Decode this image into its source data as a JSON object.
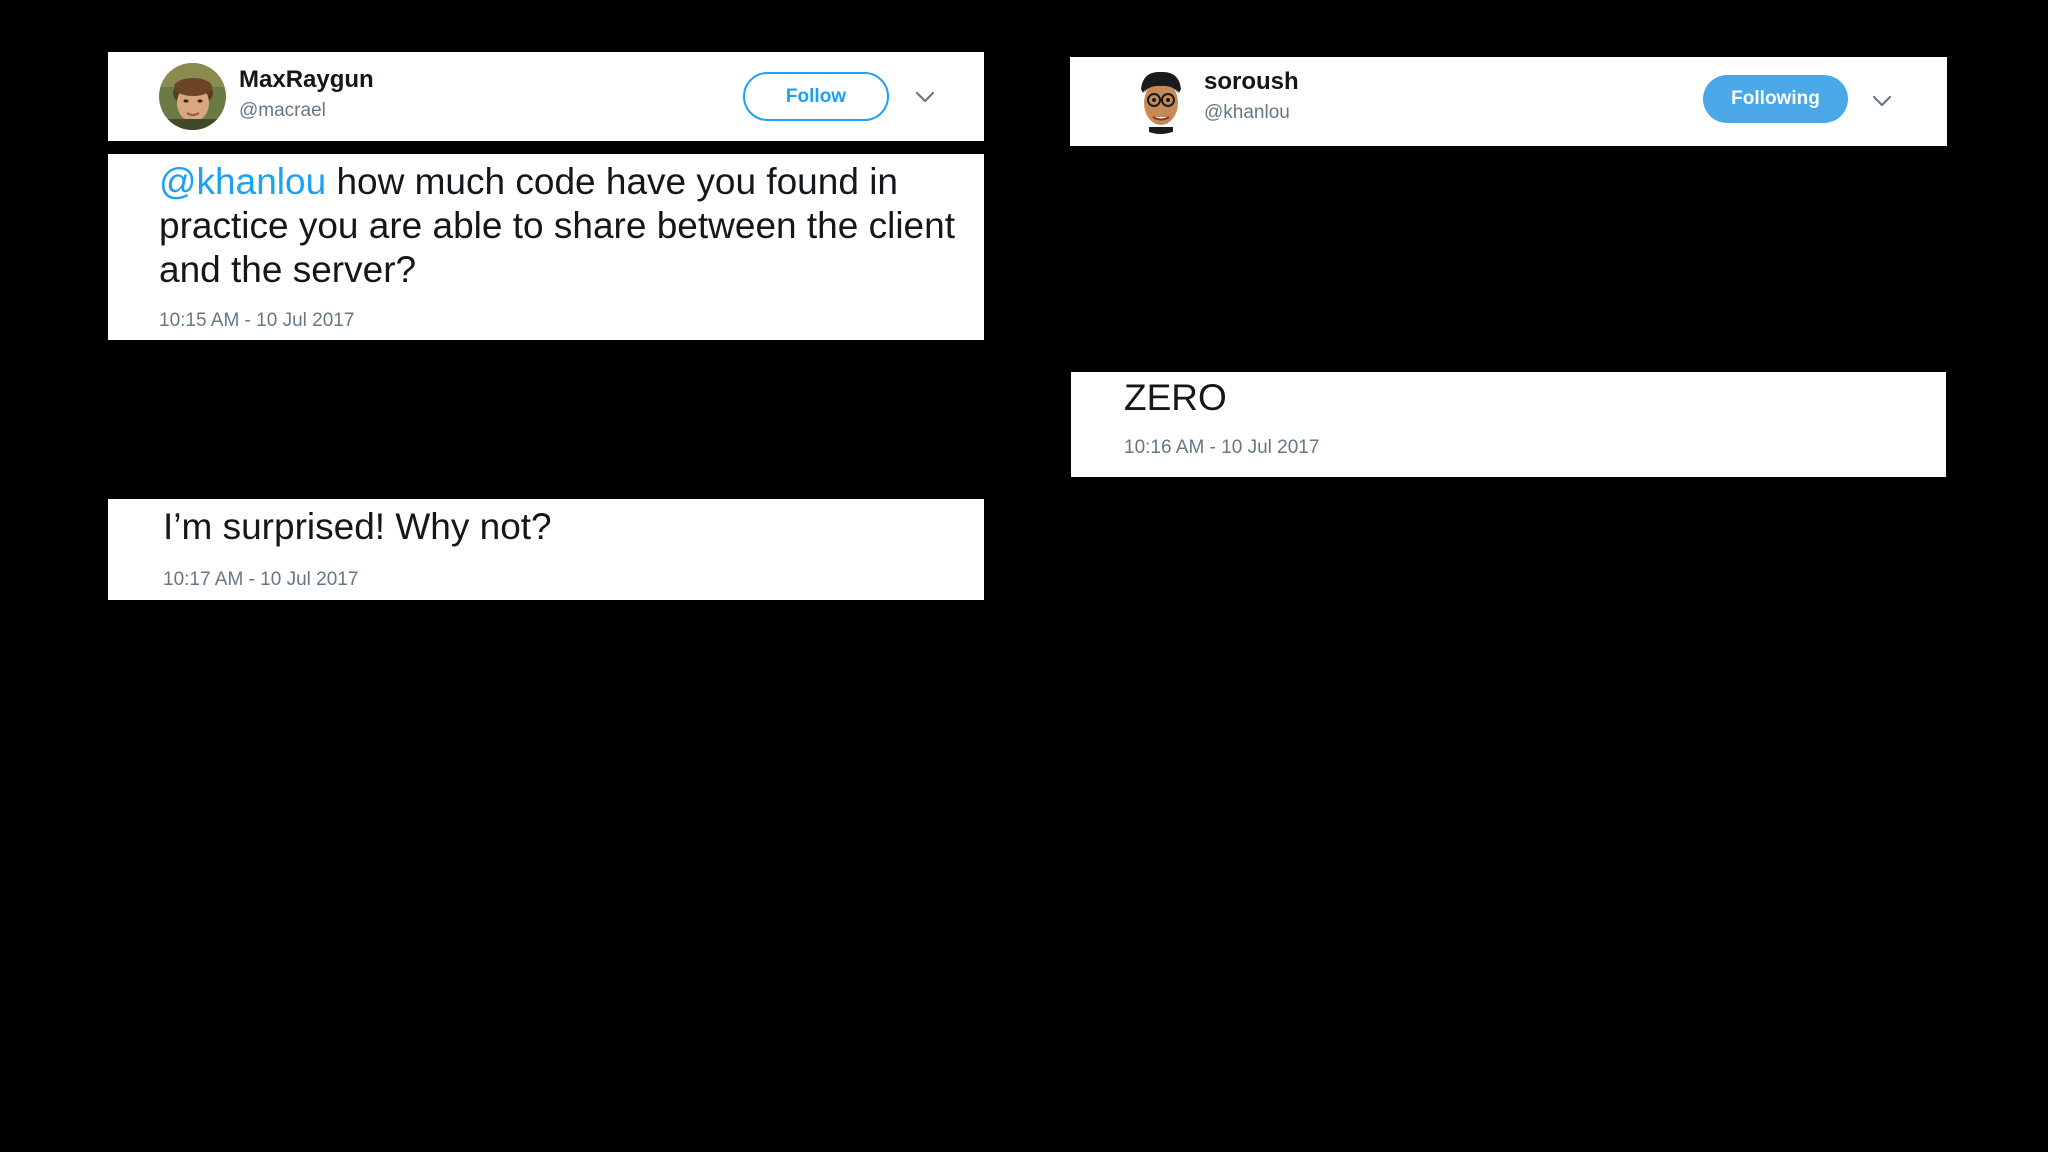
{
  "tweets": {
    "max": {
      "display_name": "MaxRaygun",
      "handle": "@macrael",
      "follow_label": "Follow",
      "tweet1": {
        "mention": "@khanlou",
        "text": " how much code have you found in practice you are able to share between the client and the server?",
        "timestamp": "10:15 AM - 10 Jul 2017"
      },
      "tweet2": {
        "text": "I’m surprised! Why not?",
        "timestamp": "10:17 AM - 10 Jul 2017"
      }
    },
    "soroush": {
      "display_name": "soroush",
      "handle": "@khanlou",
      "follow_label": "Following",
      "tweet1": {
        "text": "ZERO",
        "timestamp": "10:16 AM - 10 Jul 2017"
      }
    }
  },
  "colors": {
    "background": "#000000",
    "card": "#ffffff",
    "twitter_blue": "#1da1f2",
    "following_blue": "#4aa8e8",
    "secondary_text": "#657786",
    "primary_text": "#14171a"
  },
  "icons": {
    "chevron": "chevron-down-icon",
    "avatar_max": "avatar-photo",
    "avatar_soroush": "avatar-cartoon"
  }
}
